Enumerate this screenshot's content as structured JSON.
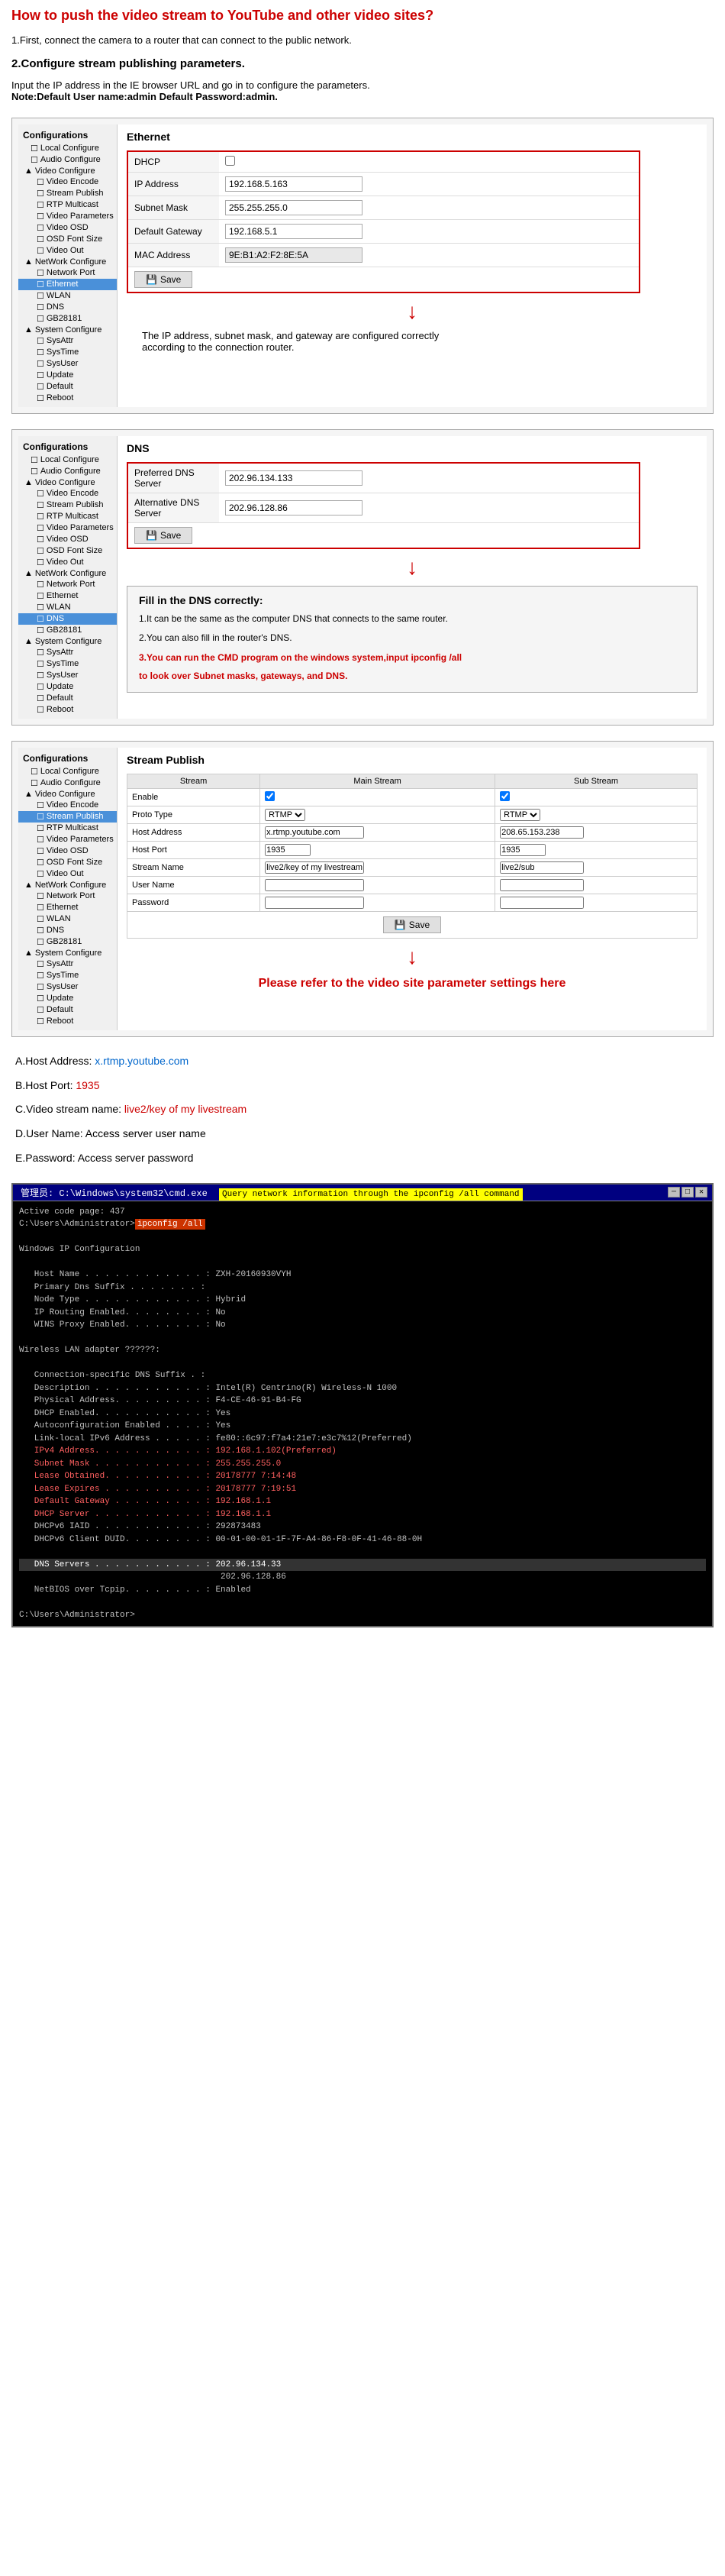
{
  "page": {
    "main_title": "How to push the video stream to YouTube and other video sites?",
    "intro_step1": "1.First, connect the camera to a router that can connect to the public network.",
    "intro_step2": "2.Configure stream publishing parameters.",
    "intro_note": "Input  the IP address in the IE browser URL and go in to configure the parameters.",
    "intro_note2": "Note:Default User name:admin  Default Password:admin."
  },
  "section1": {
    "sidebar_title": "Configurations",
    "items": [
      {
        "label": "Local Configure",
        "level": 2,
        "icon": "checkbox"
      },
      {
        "label": "Audio Configure",
        "level": 2,
        "icon": "checkbox"
      },
      {
        "label": "Video Configure",
        "level": 1,
        "icon": "arrow",
        "expanded": true
      },
      {
        "label": "Video Encode",
        "level": 3,
        "icon": "checkbox"
      },
      {
        "label": "Stream Publish",
        "level": 3,
        "icon": "checkbox"
      },
      {
        "label": "RTP Multicast",
        "level": 3,
        "icon": "checkbox"
      },
      {
        "label": "Video Parameters",
        "level": 3,
        "icon": "checkbox"
      },
      {
        "label": "Video OSD",
        "level": 3,
        "icon": "checkbox"
      },
      {
        "label": "OSD Font Size",
        "level": 3,
        "icon": "checkbox"
      },
      {
        "label": "Video Out",
        "level": 3,
        "icon": "checkbox"
      },
      {
        "label": "NetWork Configure",
        "level": 1,
        "icon": "arrow",
        "expanded": true
      },
      {
        "label": "Network Port",
        "level": 3,
        "icon": "checkbox"
      },
      {
        "label": "Ethernet",
        "level": 3,
        "icon": "checkbox",
        "selected": true
      },
      {
        "label": "WLAN",
        "level": 3,
        "icon": "checkbox"
      },
      {
        "label": "DNS",
        "level": 3,
        "icon": "checkbox"
      },
      {
        "label": "GB28181",
        "level": 3,
        "icon": "checkbox"
      },
      {
        "label": "System Configure",
        "level": 1,
        "icon": "arrow",
        "expanded": true
      },
      {
        "label": "SysAttr",
        "level": 3,
        "icon": "checkbox"
      },
      {
        "label": "SysTime",
        "level": 3,
        "icon": "checkbox"
      },
      {
        "label": "SysUser",
        "level": 3,
        "icon": "checkbox"
      },
      {
        "label": "Update",
        "level": 3,
        "icon": "checkbox"
      },
      {
        "label": "Default",
        "level": 3,
        "icon": "checkbox"
      },
      {
        "label": "Reboot",
        "level": 3,
        "icon": "checkbox"
      }
    ],
    "content_title": "Ethernet",
    "fields": [
      {
        "label": "DHCP",
        "type": "checkbox",
        "value": ""
      },
      {
        "label": "IP Address",
        "type": "text",
        "value": "192.168.5.163"
      },
      {
        "label": "Subnet Mask",
        "type": "text",
        "value": "255.255.255.0"
      },
      {
        "label": "Default Gateway",
        "type": "text",
        "value": "192.168.5.1"
      },
      {
        "label": "MAC Address",
        "type": "text",
        "value": "9E:B1:A2:F2:8E:5A",
        "readonly": true
      }
    ],
    "save_label": "Save",
    "result_text": "The IP address, subnet mask, and gateway are configured correctly",
    "result_text2": "according to the connection router."
  },
  "section2": {
    "content_title": "DNS",
    "fields": [
      {
        "label": "Preferred DNS Server",
        "type": "text",
        "value": "202.96.134.133"
      },
      {
        "label": "Alternative DNS Server",
        "type": "text",
        "value": "202.96.128.86"
      }
    ],
    "save_label": "Save",
    "fill_title": "Fill in the DNS correctly:",
    "steps": [
      "1.It can be the same as the computer DNS that connects to the same router.",
      "2.You can also fill in the router's DNS.",
      "3.You can run the CMD program on the windows system,input ipconfig /all",
      "to look over Subnet masks, gateways, and DNS."
    ]
  },
  "section3": {
    "content_title": "Stream Publish",
    "col_main": "Main Stream",
    "col_sub": "Sub Stream",
    "rows": [
      {
        "label": "Enable",
        "main": "☑",
        "sub": "☑"
      },
      {
        "label": "Proto Type",
        "main": "RTMP",
        "sub": "RTMP"
      },
      {
        "label": "Host Address",
        "main": "x.rtmp.youtube.com",
        "sub": "208.65.153.238"
      },
      {
        "label": "Host Port",
        "main": "1935",
        "sub": "1935"
      },
      {
        "label": "Stream Name",
        "main": "live2/key of my livestream",
        "sub": "live2/sub"
      },
      {
        "label": "User Name",
        "main": "",
        "sub": ""
      },
      {
        "label": "Password",
        "main": "",
        "sub": ""
      }
    ],
    "save_label": "Save",
    "refer_text": "Please refer to the video site parameter settings here"
  },
  "summary": {
    "a_label": "A.Host Address: ",
    "a_value": "x.rtmp.youtube.com",
    "b_label": "B.Host Port: ",
    "b_value": "1935",
    "c_label": "C.Video stream name: ",
    "c_value": "live2/key of my livestream",
    "d_label": "D.User Name: Access server user name",
    "e_label": "E.Password: Access server password"
  },
  "cmd": {
    "titlebar": "管理员: C:\\Windows\\system32\\cmd.exe",
    "highlight_text": "Query network information through the ipconfig /all command",
    "prompt": "C:\\Users\\Administrator>",
    "command": "ipconfig /all",
    "output": [
      "",
      "Windows IP Configuration",
      "",
      "   Host Name . . . . . . . . . . . . : ZXH-20160930VYH",
      "   Primary Dns Suffix  . . . . . . . :",
      "   Node Type . . . . . . . . . . . . : Hybrid",
      "   IP Routing Enabled. . . . . . . . : No",
      "   WINS Proxy Enabled. . . . . . . . : No",
      "",
      "Wireless LAN adapter ??????:",
      "",
      "   Connection-specific DNS Suffix  . :",
      "   Description . . . . . . . . . . . : Intel(R) Centrino(R) Wireless-N 1000",
      "   Physical Address. . . . . . . . . : F4-CE-46-91-B4-FG",
      "   DHCP Enabled. . . . . . . . . . . : Yes",
      "   Autoconfiguration Enabled . . . . : Yes",
      "   Link-local IPv6 Address . . . . . : fe80::6c97:f7a4:21e7:e3c7%12(Preferred)",
      "   IPv4 Address. . . . . . . . . . . : 192.168.1.102(Preferred)",
      "   Subnet Mask . . . . . . . . . . . : 255.255.255.0",
      "   Lease Obtained. . . . . . . . . . : 20178777 7:14:48",
      "   Lease Expires . . . . . . . . . . : 20178777 7:19:51",
      "   Default Gateway . . . . . . . . . : 192.168.1.1",
      "   DHCP Server . . . . . . . . . . . : 192.168.1.1",
      "   DHCPv6 IAID . . . . . . . . . . . : 292873483",
      "   DHCPv6 Client DUID. . . . . . . . : 00-01-00-01-1F-7F-A4-86-F8-0F-41-46-88-0H",
      "",
      "   DNS Servers . . . . . . . . . . . : 202.96.134.33",
      "                                       202.96.128.86",
      "   NetBIOS over Tcpip. . . . . . . . : Enabled",
      "",
      "C:\\Users\\Administrator>"
    ],
    "highlighted_lines": {
      "subnet_mask": "   Subnet Mask . . . . . . . . . . . : 255.255.255.0",
      "default_gateway": "   Default Gateway . . . . . . . . . : 192.168.1.1",
      "dhcp_server": "   DHCP Server . . . . . . . . . . . : 192.168.1.1",
      "dns_servers_line": "   DNS Servers . . . . . . . . . . . : 202.96.134.33"
    }
  }
}
